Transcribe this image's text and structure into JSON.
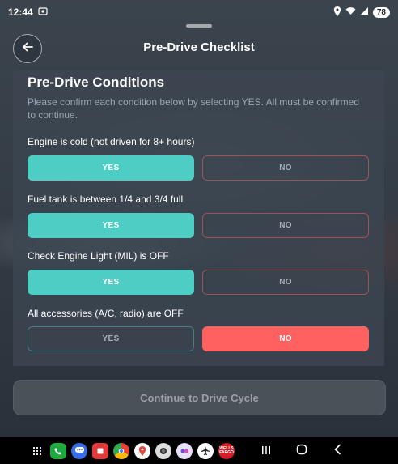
{
  "status": {
    "time": "12:44",
    "battery": "78"
  },
  "header": {
    "title": "Pre-Drive Checklist"
  },
  "card": {
    "title": "Pre-Drive Conditions",
    "description": "Please confirm each condition below by selecting YES. All must be confirmed to continue."
  },
  "conditions": [
    {
      "label": "Engine is cold (not driven for 8+ hours)",
      "yes": "YES",
      "no": "NO",
      "selected": "YES"
    },
    {
      "label": "Fuel tank is between 1/4 and 3/4 full",
      "yes": "YES",
      "no": "NO",
      "selected": "YES"
    },
    {
      "label": "Check Engine Light (MIL) is OFF",
      "yes": "YES",
      "no": "NO",
      "selected": "YES"
    },
    {
      "label": "All accessories (A/C, radio) are OFF",
      "yes": "YES",
      "no": "NO",
      "selected": "NO"
    }
  ],
  "continue_label": "Continue to Drive Cycle",
  "colors": {
    "accent": "#4ecdc4",
    "danger": "#ff6060"
  },
  "dock": {
    "apps": [
      "apps-grid-icon",
      "phone-icon",
      "messages-icon",
      "sticker-icon",
      "chrome-icon",
      "maps-icon",
      "camera-icon",
      "app-icon",
      "plane-icon",
      "bank-icon"
    ],
    "bank_text": "WELLS FARGO"
  }
}
